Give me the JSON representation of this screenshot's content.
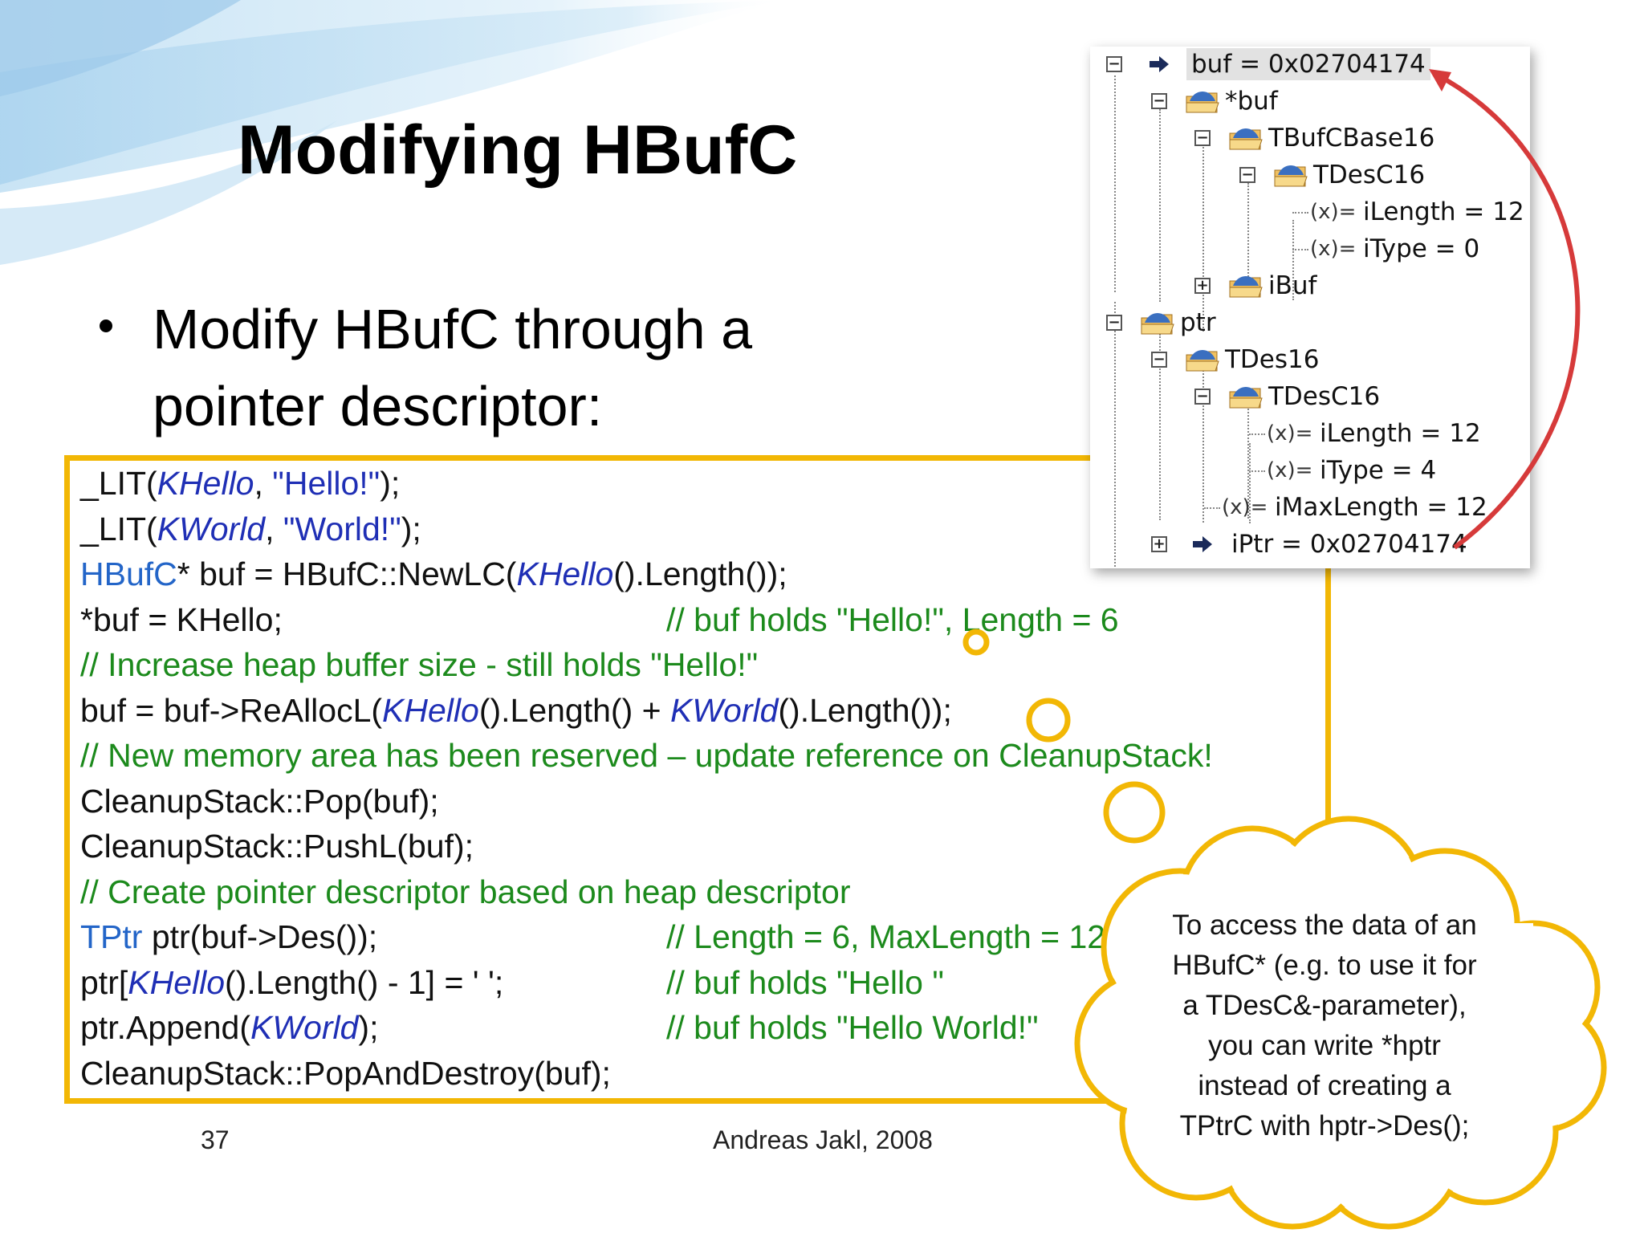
{
  "slide": {
    "title": "Modifying HBufC",
    "bullet": "Modify HBufC through a pointer descriptor:",
    "page_number": "37",
    "author": "Andreas Jakl, 2008",
    "accent_color": "#f2b705",
    "comment_color": "#1c8a1c",
    "keyword_color": "#2365c8"
  },
  "code": {
    "l1": {
      "a": "_LIT(",
      "b": "KHello",
      "c": ", ",
      "d": "\"Hello!\"",
      "e": ");"
    },
    "l2": {
      "a": "_LIT(",
      "b": "KWorld",
      "c": ", ",
      "d": "\"World!\"",
      "e": ");"
    },
    "l3": {
      "a": "HBufC",
      "b": "* buf = HBufC::NewLC(",
      "c": "KHello",
      "d": "().Length());"
    },
    "l4": {
      "a": "*buf = KHello;",
      "comment": "// buf holds \"Hello!\", Length = 6"
    },
    "l5": {
      "comment": "// Increase heap buffer size - still holds \"Hello!\""
    },
    "l6": {
      "a": "buf = buf->ReAllocL(",
      "b": "KHello",
      "c": "().Length() + ",
      "d": "KWorld",
      "e": "().Length());"
    },
    "l7": {
      "comment": "// New memory area has been reserved – update reference on CleanupStack!"
    },
    "l8": {
      "a": "CleanupStack::Pop(buf);"
    },
    "l9": {
      "a": "CleanupStack::PushL(buf);"
    },
    "l10": {
      "comment": "// Create pointer descriptor based on heap descriptor"
    },
    "l11": {
      "a": "TPtr",
      "b": " ptr(buf->Des());",
      "comment": "// Length = 6, MaxLength = 12"
    },
    "l12": {
      "a": "ptr[",
      "b": "KHello",
      "c": "().Length() - 1] = ' ';",
      "comment": "// buf holds \"Hello \""
    },
    "l13": {
      "a": "ptr.Append(",
      "b": "KWorld",
      "c": ");",
      "comment": "// buf holds \"Hello World!\""
    },
    "l14": {
      "a": "CleanupStack::PopAndDestroy(buf);"
    }
  },
  "debugger": {
    "rows": [
      {
        "label": "buf = 0x02704174",
        "icon": "arrow-icon",
        "toggle": "−"
      },
      {
        "label": "*buf",
        "icon": "folder-icon",
        "toggle": "−"
      },
      {
        "label": "TBufCBase16",
        "icon": "folder-icon",
        "toggle": "−"
      },
      {
        "label": "TDesC16",
        "icon": "folder-icon",
        "toggle": "−"
      },
      {
        "label": "iLength = 12",
        "icon": "variable-icon"
      },
      {
        "label": "iType = 0",
        "icon": "variable-icon"
      },
      {
        "label": "iBuf",
        "icon": "folder-icon",
        "toggle": "+"
      },
      {
        "label": "ptr",
        "icon": "folder-icon",
        "toggle": "−"
      },
      {
        "label": "TDes16",
        "icon": "folder-icon",
        "toggle": "−"
      },
      {
        "label": "TDesC16",
        "icon": "folder-icon",
        "toggle": "−"
      },
      {
        "label": "iLength = 12",
        "icon": "variable-icon"
      },
      {
        "label": "iType = 4",
        "icon": "variable-icon"
      },
      {
        "label": "iMaxLength = 12",
        "icon": "variable-icon"
      },
      {
        "label": "iPtr = 0x02704174",
        "icon": "arrow-icon",
        "toggle": "+"
      }
    ],
    "var_glyph": "(x)="
  },
  "callout": {
    "line1": "To access the data of an",
    "line2": "HBufC* (e.g. to use it for",
    "line3": "a TDesC&-parameter),",
    "line4": "you can write *hptr",
    "line5": "instead of creating a",
    "line6": "TPtrC with hptr->Des();"
  }
}
